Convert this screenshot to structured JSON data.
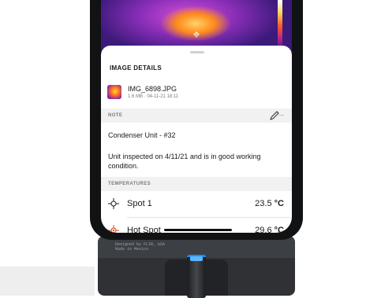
{
  "image_details": {
    "title": "IMAGE DETAILS",
    "file": {
      "name": "IMG_6898.JPG",
      "meta": "1.6 MB · 04-11-21 18:11"
    }
  },
  "note": {
    "label": "NOTE",
    "edit_ellipsis": "...",
    "title": "Condenser Unit - #32",
    "body_line1": "Unit inspected on 4/11/21 and is in good working",
    "body_line2": "condition."
  },
  "temperatures": {
    "label": "TEMPERATURES",
    "spots": [
      {
        "name": "Spot 1",
        "value": "23.5",
        "unit": "°C"
      },
      {
        "name": "Hot Spot",
        "value": "29.6",
        "unit": "°C"
      }
    ]
  },
  "colors": {
    "hot_spot": "#e04a2a",
    "accent_blue": "#1e8cff"
  },
  "device_print": "Designed by FLIR, USA\nMade in Mexico"
}
